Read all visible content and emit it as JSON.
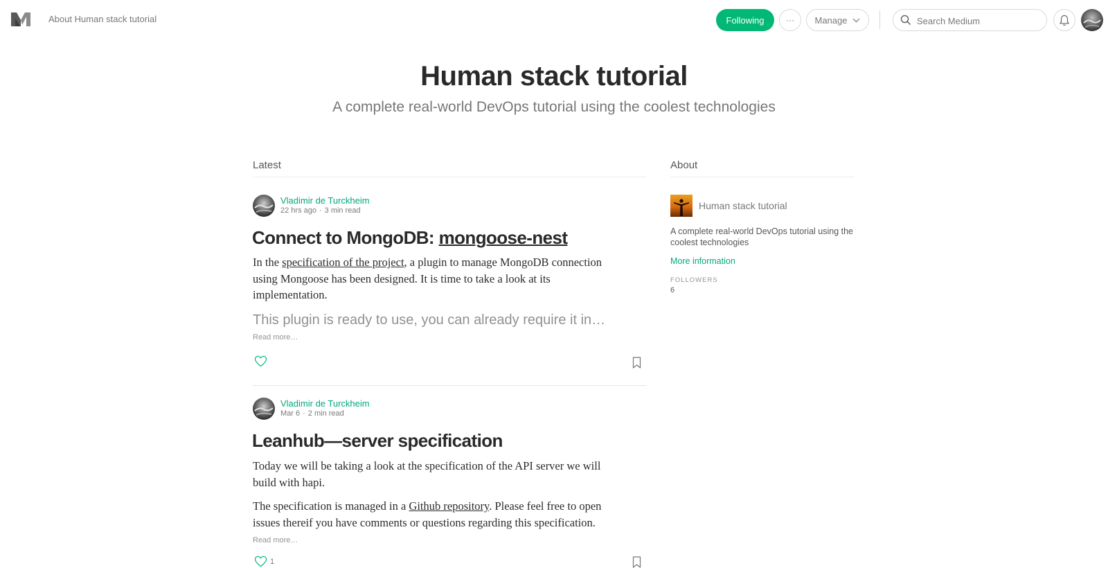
{
  "colors": {
    "accent": "#03b876",
    "link_green": "#03a87c",
    "text_dark": "#292929",
    "text_muted": "#757575"
  },
  "topbar": {
    "logo_icon": "medium-logo-icon",
    "publication_link": "About Human stack tutorial",
    "following_label": "Following",
    "more_label": "···",
    "manage_label": "Manage",
    "search_placeholder": "Search Medium",
    "notifications_icon": "bell-icon"
  },
  "hero": {
    "title": "Human stack tutorial",
    "subtitle": "A complete real-world DevOps tutorial using the coolest technologies"
  },
  "latest": {
    "heading": "Latest",
    "posts": [
      {
        "author": "Vladimir de Turckheim",
        "date": "22 hrs ago",
        "read_time": "3 min read",
        "title_prefix": "Connect to MongoDB: ",
        "title_link": "mongoose-nest",
        "p1_before": "In the ",
        "p1_link": "specification of the project",
        "p1_after": ", a plugin to manage MongoDB connection using Mongoose has been designed. It is time to take a look at its implementation.",
        "kicker": "This plugin is ready to use, you can already require it in…",
        "read_more": "Read more…"
      },
      {
        "author": "Vladimir de Turckheim",
        "date": "Mar 6",
        "read_time": "2 min read",
        "title": "Leanhub—server specification",
        "p1": "Today we will be taking a look at the specification of the API server we will build with hapi.",
        "p2_before": "The specification is managed in a ",
        "p2_link": "Github repository",
        "p2_after": ". Please feel free to open issues thereif you have comments or questions regarding this specification.",
        "read_more": "Read more…",
        "claps": "1"
      }
    ]
  },
  "about": {
    "heading": "About",
    "name": "Human stack tutorial",
    "description": "A complete real-world DevOps tutorial using the coolest technologies",
    "more_information": "More information",
    "followers_label": "FOLLOWERS",
    "followers_count": "6"
  }
}
